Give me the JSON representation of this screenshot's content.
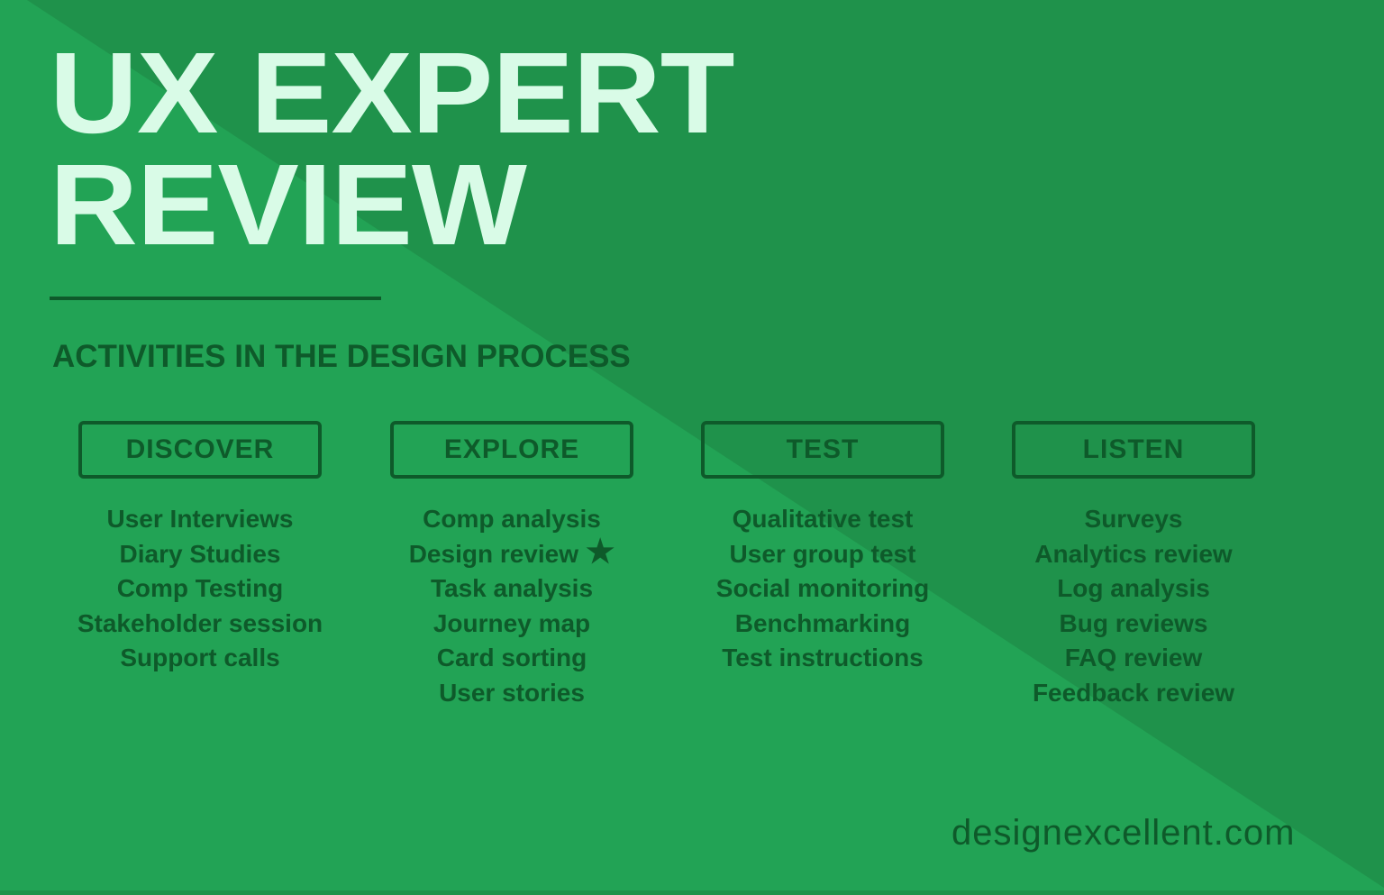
{
  "title_lines": [
    "UX EXPERT",
    "REVIEW"
  ],
  "subtitle": "ACTIVITIES IN THE DESIGN PROCESS",
  "colors": {
    "light_green": "#22a355",
    "dark_green": "#1f924b",
    "text_dark": "#0e5a2a",
    "title_text": "#d9fbe7"
  },
  "columns": [
    {
      "heading": "DISCOVER",
      "items": [
        "User Interviews",
        "Diary Studies",
        "Comp Testing",
        "Stakeholder session",
        "Support calls"
      ]
    },
    {
      "heading": "EXPLORE",
      "items": [
        "Comp analysis",
        "Design review",
        "Task analysis",
        "Journey map",
        "Card sorting",
        "User stories"
      ],
      "starred_item": "Design review"
    },
    {
      "heading": "TEST",
      "items": [
        "Qualitative test",
        "User group test",
        "Social monitoring",
        "Benchmarking",
        "Test instructions"
      ]
    },
    {
      "heading": "LISTEN",
      "items": [
        "Surveys",
        "Analytics review",
        "Log analysis",
        "Bug reviews",
        "FAQ review",
        "Feedback review"
      ]
    }
  ],
  "star_icon": "★",
  "footer": "designexcellent.com"
}
